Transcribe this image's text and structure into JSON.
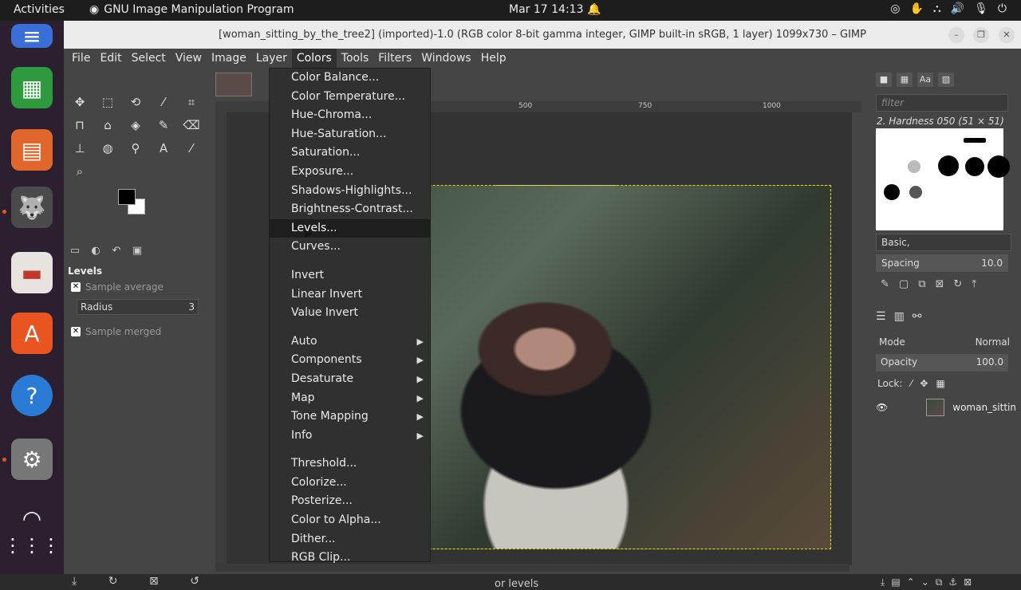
{
  "topbar": {
    "activities": "Activities",
    "app_name": "GNU Image Manipulation Program",
    "clock": "Mar 17  14:13"
  },
  "window": {
    "title": "[woman_sitting_by_the_tree2] (imported)-1.0 (RGB color 8-bit gamma integer, GIMP built-in sRGB, 1 layer) 1099x730 – GIMP"
  },
  "menubar": [
    "File",
    "Edit",
    "Select",
    "View",
    "Image",
    "Layer",
    "Colors",
    "Tools",
    "Filters",
    "Windows",
    "Help"
  ],
  "tool_options": {
    "heading": "Levels",
    "sample_average": "Sample average",
    "radius_label": "Radius",
    "radius_value": "3",
    "sample_merged": "Sample merged"
  },
  "colors_menu": {
    "group1": [
      "Color Balance...",
      "Color Temperature...",
      "Hue-Chroma...",
      "Hue-Saturation...",
      "Saturation...",
      "Exposure...",
      "Shadows-Highlights...",
      "Brightness-Contrast...",
      "Levels...",
      "Curves..."
    ],
    "group2": [
      "Invert",
      "Linear Invert",
      "Value Invert"
    ],
    "group3": [
      "Auto",
      "Components",
      "Desaturate",
      "Map",
      "Tone Mapping",
      "Info"
    ],
    "group4": [
      "Threshold...",
      "Colorize...",
      "Posterize...",
      "Color to Alpha...",
      "Dither...",
      "RGB Clip..."
    ],
    "highlighted": "Levels..."
  },
  "ruler": [
    "500",
    "750",
    "1000"
  ],
  "status": "or levels",
  "brushes": {
    "filter_placeholder": "filter",
    "current": "2. Hardness 050 (51 × 51)",
    "preset": "Basic,",
    "spacing_label": "Spacing",
    "spacing_value": "10.0"
  },
  "layers": {
    "mode_label": "Mode",
    "mode_value": "Normal",
    "opacity_label": "Opacity",
    "opacity_value": "100.0",
    "lock_label": "Lock:",
    "layer_name": "woman_sittin"
  },
  "colors": {
    "accent": "#e95420",
    "menu_bg": "#303030",
    "selection_dash": "#e8e000"
  }
}
